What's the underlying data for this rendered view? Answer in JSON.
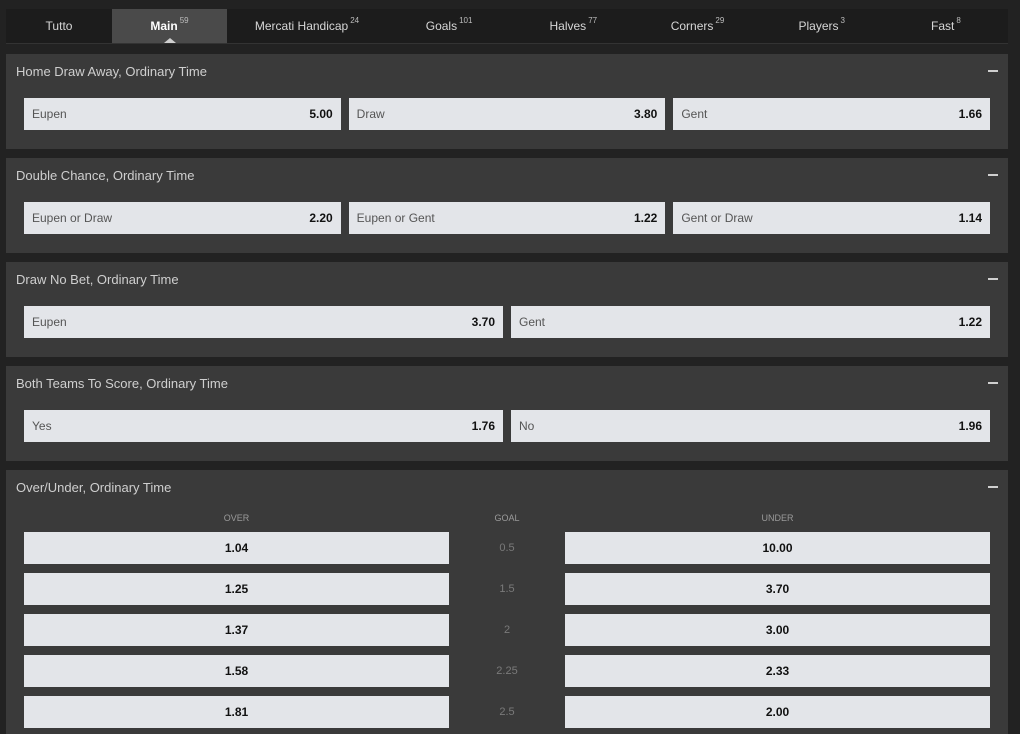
{
  "tabs": [
    {
      "label": "Tutto",
      "count": ""
    },
    {
      "label": "Main",
      "count": "59"
    },
    {
      "label": "Mercati Handicap",
      "count": "24"
    },
    {
      "label": "Goals",
      "count": "101"
    },
    {
      "label": "Halves",
      "count": "77"
    },
    {
      "label": "Corners",
      "count": "29"
    },
    {
      "label": "Players",
      "count": "3"
    },
    {
      "label": "Fast",
      "count": "8"
    }
  ],
  "markets": {
    "hda": {
      "title": "Home Draw Away, Ordinary Time",
      "odds": [
        {
          "name": "Eupen",
          "value": "5.00"
        },
        {
          "name": "Draw",
          "value": "3.80"
        },
        {
          "name": "Gent",
          "value": "1.66"
        }
      ]
    },
    "dc": {
      "title": "Double Chance, Ordinary Time",
      "odds": [
        {
          "name": "Eupen or Draw",
          "value": "2.20"
        },
        {
          "name": "Eupen or Gent",
          "value": "1.22"
        },
        {
          "name": "Gent or Draw",
          "value": "1.14"
        }
      ]
    },
    "dnb": {
      "title": "Draw No Bet, Ordinary Time",
      "odds": [
        {
          "name": "Eupen",
          "value": "3.70"
        },
        {
          "name": "Gent",
          "value": "1.22"
        }
      ]
    },
    "btts": {
      "title": "Both Teams To Score, Ordinary Time",
      "odds": [
        {
          "name": "Yes",
          "value": "1.76"
        },
        {
          "name": "No",
          "value": "1.96"
        }
      ]
    },
    "ou": {
      "title": "Over/Under, Ordinary Time",
      "headers": {
        "over": "OVER",
        "goal": "GOAL",
        "under": "UNDER"
      },
      "rows": [
        {
          "over": "1.04",
          "goal": "0.5",
          "under": "10.00"
        },
        {
          "over": "1.25",
          "goal": "1.5",
          "under": "3.70"
        },
        {
          "over": "1.37",
          "goal": "2",
          "under": "3.00"
        },
        {
          "over": "1.58",
          "goal": "2.25",
          "under": "2.33"
        },
        {
          "over": "1.81",
          "goal": "2.5",
          "under": "2.00"
        }
      ]
    }
  }
}
